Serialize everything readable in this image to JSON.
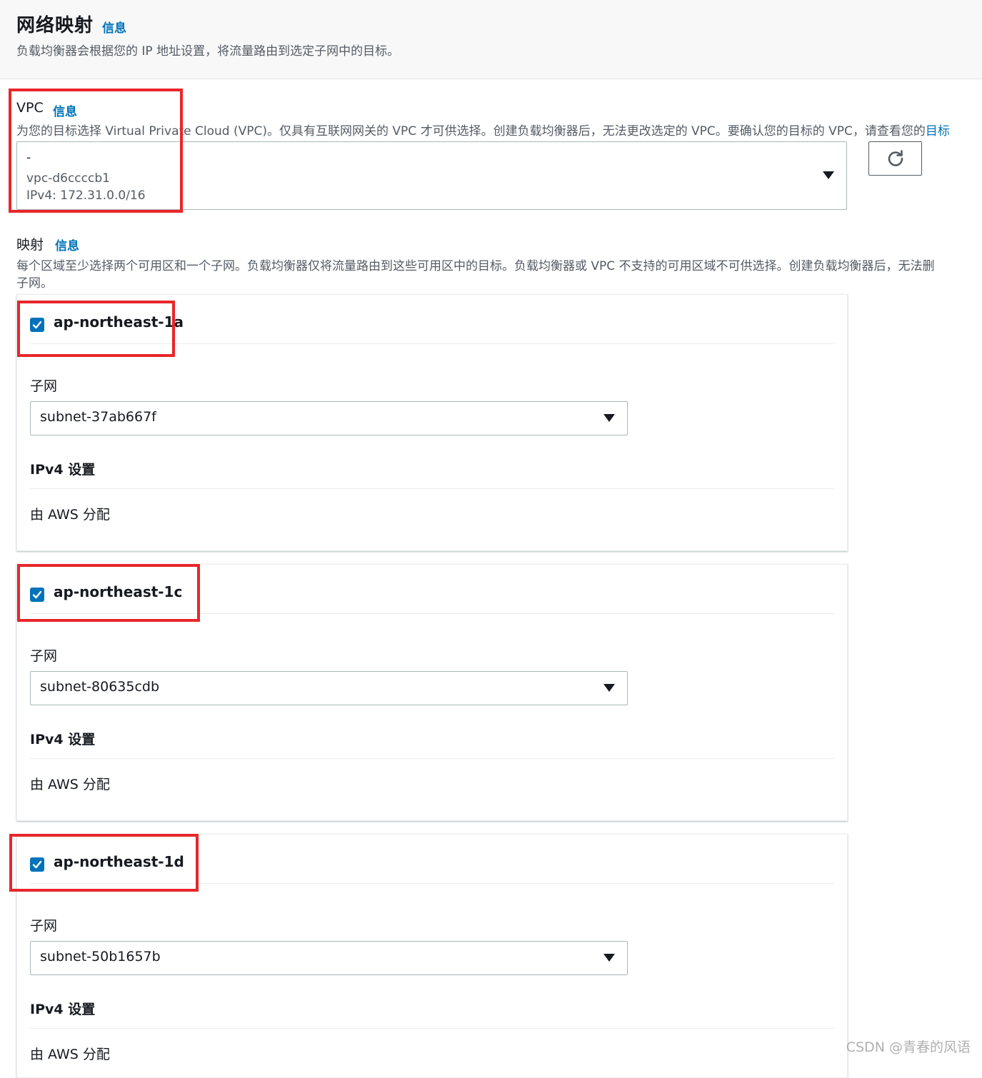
{
  "header": {
    "title": "网络映射",
    "info": "信息",
    "description": "负载均衡器会根据您的 IP 地址设置，将流量路由到选定子网中的目标。"
  },
  "vpc": {
    "label": "VPC",
    "info": "信息",
    "description": "为您的目标选择 Virtual Private Cloud (VPC)。仅具有互联网网关的 VPC 才可供选择。创建负载均衡器后，无法更改选定的 VPC。要确认您的目标的 VPC，请查看您的",
    "description_link": "目标",
    "selected": {
      "name": "-",
      "id": "vpc-d6ccccb1",
      "cidr": "IPv4: 172.31.0.0/16"
    },
    "refresh_icon": "refresh-icon"
  },
  "mappings": {
    "label": "映射",
    "info": "信息",
    "description_line1": "每个区域至少选择两个可用区和一个子网。负载均衡器仅将流量路由到这些可用区中的目标。负载均衡器或 VPC 不支持的可用区域不可供选择。创建负载均衡器后，无法删",
    "description_line2": "子网。",
    "zones": [
      {
        "name": "ap-northeast-1a",
        "checked": true,
        "subnet_label": "子网",
        "subnet": "subnet-37ab667f",
        "ipv4_heading": "IPv4 设置",
        "ipv4_value": "由 AWS 分配"
      },
      {
        "name": "ap-northeast-1c",
        "checked": true,
        "subnet_label": "子网",
        "subnet": "subnet-80635cdb",
        "ipv4_heading": "IPv4 设置",
        "ipv4_value": "由 AWS 分配"
      },
      {
        "name": "ap-northeast-1d",
        "checked": true,
        "subnet_label": "子网",
        "subnet": "subnet-50b1657b",
        "ipv4_heading": "IPv4 设置",
        "ipv4_value": "由 AWS 分配"
      }
    ]
  },
  "watermark": "CSDN @青春的风语",
  "colors": {
    "link": "#0073bb",
    "checkbox": "#0073bb",
    "highlight": "#e8262b"
  }
}
